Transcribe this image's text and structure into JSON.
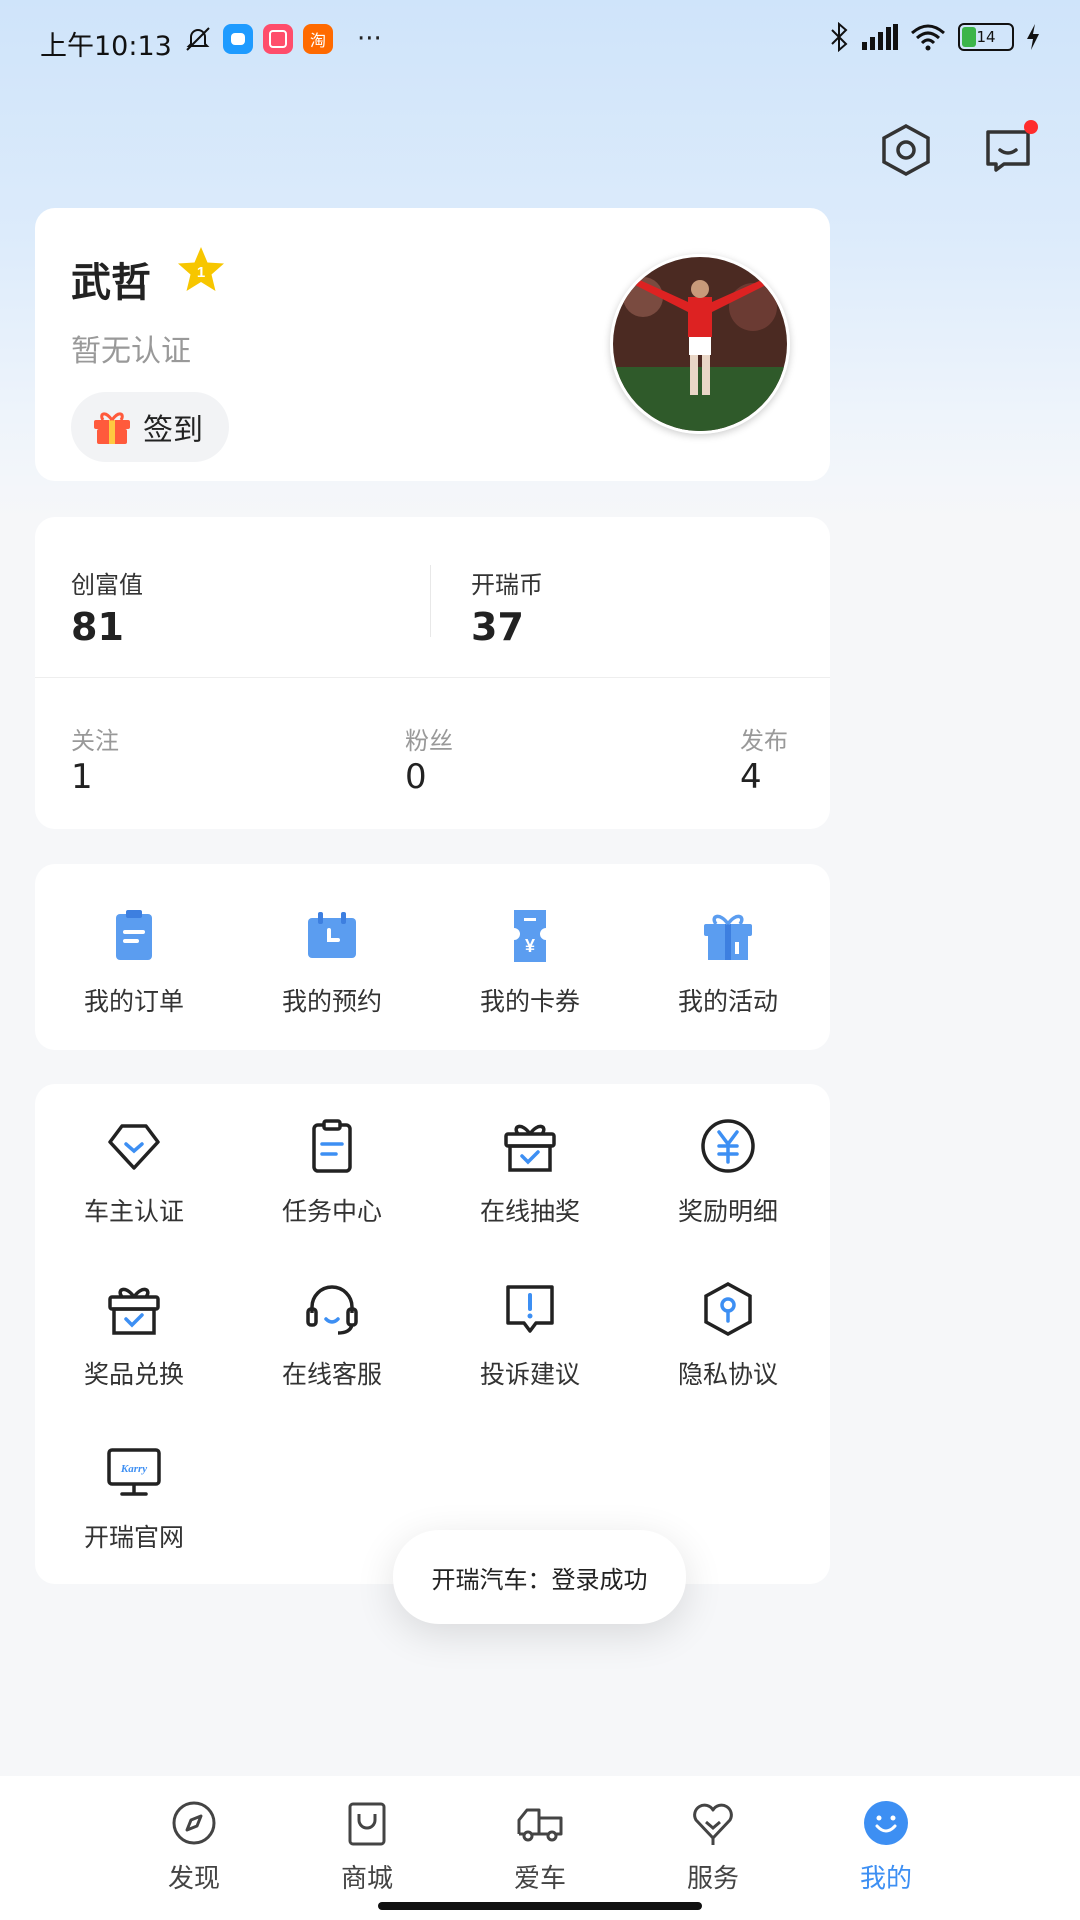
{
  "status_bar": {
    "time": "上午10:13",
    "apps": [
      {
        "icon": "message-app-icon",
        "color": "#1e9bff"
      },
      {
        "icon": "kuaishou-app-icon",
        "color": "#ff4d6b"
      },
      {
        "icon": "taobao-app-icon",
        "color": "#ff6a00",
        "text": "淘"
      }
    ],
    "more": "···",
    "battery": "14"
  },
  "profile": {
    "name": "武哲",
    "level": "1",
    "certification": "暂无认证",
    "checkin_label": "签到"
  },
  "stats": {
    "wealth_label": "创富值",
    "wealth_value": "81",
    "coin_label": "开瑞币",
    "coin_value": "37",
    "follow_label": "关注",
    "follow_value": "1",
    "fans_label": "粉丝",
    "fans_value": "0",
    "posts_label": "发布",
    "posts_value": "4"
  },
  "orders": [
    {
      "label": "我的订单",
      "icon": "order-icon"
    },
    {
      "label": "我的预约",
      "icon": "calendar-icon"
    },
    {
      "label": "我的卡券",
      "icon": "coupon-icon"
    },
    {
      "label": "我的活动",
      "icon": "gift-box-icon"
    }
  ],
  "services": [
    {
      "label": "车主认证",
      "icon": "diamond-check-icon"
    },
    {
      "label": "任务中心",
      "icon": "clipboard-icon"
    },
    {
      "label": "在线抽奖",
      "icon": "gift-check-icon"
    },
    {
      "label": "奖励明细",
      "icon": "yuan-icon"
    },
    {
      "label": "奖品兑换",
      "icon": "prize-box-icon"
    },
    {
      "label": "在线客服",
      "icon": "headset-icon"
    },
    {
      "label": "投诉建议",
      "icon": "feedback-icon"
    },
    {
      "label": "隐私协议",
      "icon": "privacy-icon"
    },
    {
      "label": "开瑞官网",
      "icon": "monitor-icon",
      "logo_text": "Karry"
    }
  ],
  "toast": "开瑞汽车：登录成功",
  "tabs": [
    {
      "label": "发现",
      "icon": "compass-icon"
    },
    {
      "label": "商城",
      "icon": "shopping-bag-icon"
    },
    {
      "label": "爱车",
      "icon": "truck-icon"
    },
    {
      "label": "服务",
      "icon": "heart-service-icon"
    },
    {
      "label": "我的",
      "icon": "smile-icon",
      "active": true
    }
  ],
  "colors": {
    "accent": "#3d8ff3",
    "order_icon": "#5b9df0",
    "badge_red": "#ff2d2d",
    "star": "#f7c600"
  }
}
